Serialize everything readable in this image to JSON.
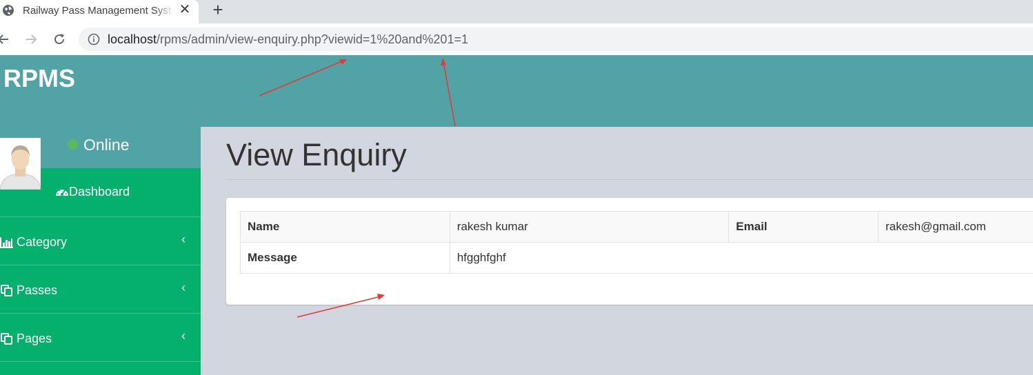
{
  "browser": {
    "tab_title": "Railway Pass Management System",
    "new_tab_label": "+",
    "close_label": "✕",
    "url_host": "localhost",
    "url_path": "/rpms/admin/view-enquiry.php?viewid=1%20and%201=1"
  },
  "header": {
    "brand": "RPMS"
  },
  "sidebar": {
    "status": "Online",
    "status_color": "#5cb85c",
    "items": [
      {
        "label": "Dashboard",
        "icon": "dashboard-icon"
      },
      {
        "label": "Category",
        "icon": "bar-chart-icon",
        "chevron": "‹"
      },
      {
        "label": "Passes",
        "icon": "copy-icon",
        "chevron": "‹"
      },
      {
        "label": "Pages",
        "icon": "copy-icon",
        "chevron": "‹"
      }
    ]
  },
  "main": {
    "title": "View Enquiry",
    "details": {
      "name_label": "Name",
      "name_value": "rakesh kumar",
      "email_label": "Email",
      "email_value": "rakesh@gmail.com",
      "message_label": "Message",
      "message_value": "hfgghfghf"
    }
  },
  "colors": {
    "header": "#52a3a6",
    "sidebar": "#05b06d",
    "content_bg": "#d2d6de",
    "annotation_arrow": "#e53935"
  }
}
